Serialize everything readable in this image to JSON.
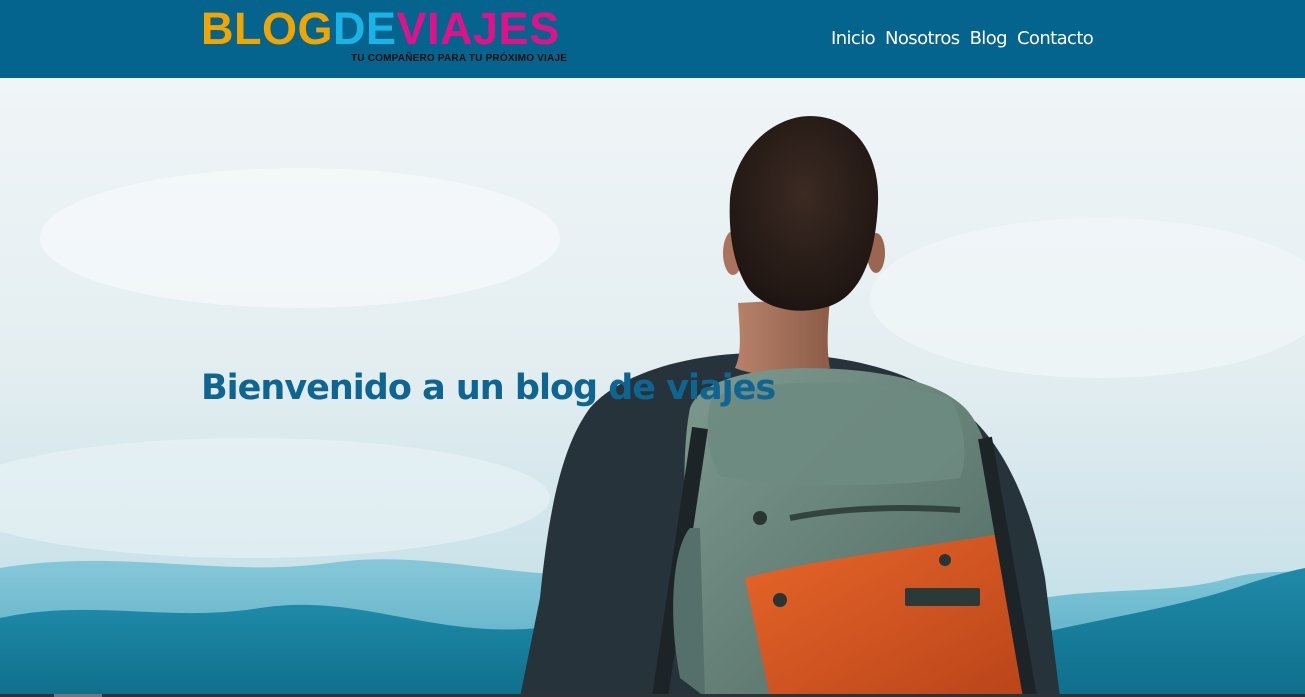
{
  "brand": {
    "logo_parts": [
      {
        "text": "BLOG",
        "color": "#f0a500"
      },
      {
        "text": "DE",
        "color": "#19b3e6"
      },
      {
        "text": "VIAJES",
        "color": "#e0118a"
      }
    ],
    "tagline": "TU COMPAÑERO PARA TU PRÓXIMO VIAJE"
  },
  "nav": {
    "items": [
      {
        "label": "Inicio"
      },
      {
        "label": "Nosotros"
      },
      {
        "label": "Blog"
      },
      {
        "label": "Contacto"
      }
    ]
  },
  "hero": {
    "title": "Bienvenido a un blog de viajes"
  },
  "colors": {
    "header_bg": "#04648e",
    "title_color": "#0f6591"
  }
}
